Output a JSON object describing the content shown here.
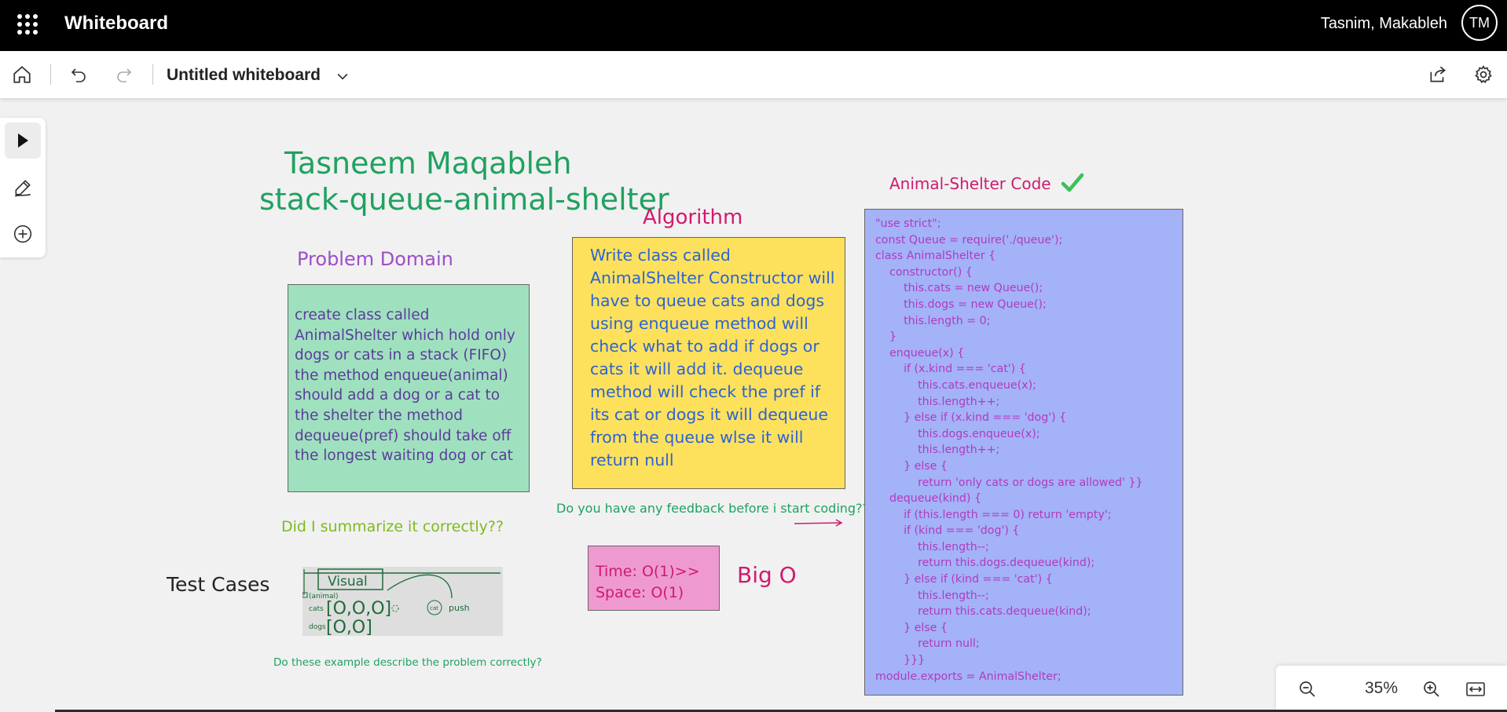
{
  "app": {
    "title": "Whiteboard",
    "user_name": "Tasnim, Makableh",
    "user_initials": "TM"
  },
  "toolbar": {
    "board_title": "Untitled whiteboard",
    "icons": [
      "home-icon",
      "undo-icon",
      "redo-icon",
      "chevron-down-icon",
      "share-icon",
      "gear-icon"
    ]
  },
  "rail": {
    "tools": [
      "select-pointer-icon",
      "pen-icon",
      "add-icon"
    ],
    "active": "select-pointer-icon"
  },
  "canvas": {
    "title_line1": "Tasneem Maqableh",
    "title_line2": "stack-queue-animal-shelter",
    "problem_heading": "Problem Domain",
    "problem_text": "create class called AnimalShelter which hold only dogs or cats in a stack (FIFO) the method enqueue(animal) should add a dog or a cat to the shelter the method dequeue(pref) should take off the longest waiting dog or cat",
    "summarize_question": "Did I summarize it correctly??",
    "algorithm_heading": "Algorithm",
    "algorithm_text": "Write class called AnimalShelter Constructor will have to queue cats and dogs using  enqueue method will check what to add if dogs or cats it will add it. dequeue method will check the pref if its cat or dogs it will dequeue from the queue wlse it will return null",
    "feedback_question": "Do you have any feedback before i start coding??",
    "test_cases_label": "Test Cases",
    "sketch": {
      "visual_label": "Visual",
      "animal_label": "(animal)",
      "cats_label": "cats",
      "dogs_label": "dogs",
      "cat_label": "cat",
      "push_label": "push"
    },
    "example_question": "Do these example describe the problem correctly?",
    "big_o_time": "Time: O(1)>>",
    "big_o_space": "Space: O(1)",
    "big_o_label": "Big O",
    "code_heading": "Animal-Shelter Code",
    "code_lines": [
      "\"use strict\";",
      "const Queue = require('./queue');",
      "class AnimalShelter {",
      "    constructor() {",
      "        this.cats = new Queue();",
      "        this.dogs = new Queue();",
      "        this.length = 0;",
      "    }",
      "    enqueue(x) {",
      "        if (x.kind === 'cat') {",
      "            this.cats.enqueue(x);",
      "            this.length++;",
      "        } else if (x.kind === 'dog') {",
      "            this.dogs.enqueue(x);",
      "            this.length++;",
      "        } else {",
      "            return 'only cats or dogs are allowed' }}",
      "    dequeue(kind) {",
      "        if (this.length === 0) return 'empty';",
      "        if (kind === 'dog') {",
      "            this.length--;",
      "            return this.dogs.dequeue(kind);",
      "        } else if (kind === 'cat') {",
      "            this.length--;",
      "            return this.cats.dequeue(kind);",
      "        } else {",
      "            return null;",
      "        }}}",
      "module.exports = AnimalShelter;"
    ]
  },
  "zoom": {
    "level": "35%"
  },
  "colors": {
    "title_green": "#1fa260",
    "note_green": "#9fe1bf",
    "note_yellow": "#fde15c",
    "note_pink": "#ee9ad0",
    "note_blue": "#a4b2f8",
    "magenta": "#d01a6e",
    "purple": "#9b4fc8"
  }
}
